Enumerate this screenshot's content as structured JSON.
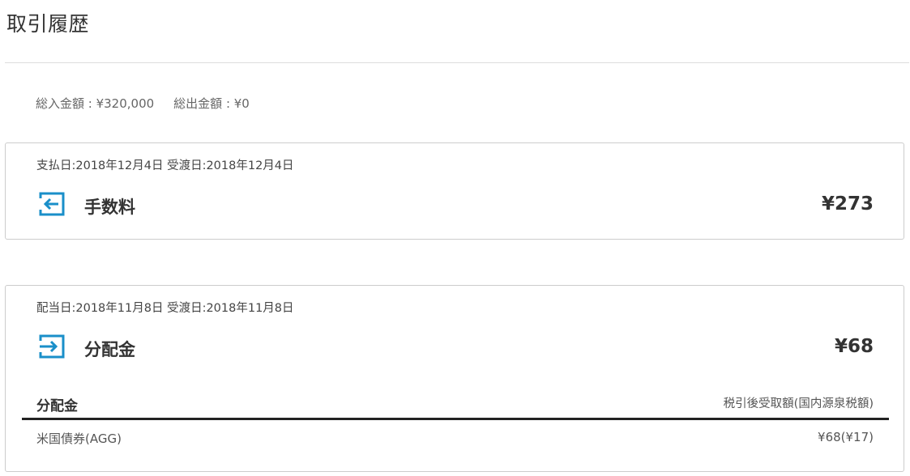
{
  "page": {
    "title": "取引履歴"
  },
  "summary": {
    "total_in": "総入金額 : ¥320,000",
    "total_out": "総出金額 : ¥0"
  },
  "colors": {
    "icon_blue": "#1a8fc9",
    "border": "#cccccc",
    "text": "#333333"
  },
  "transactions": [
    {
      "dates": "支払日:2018年12月4日 受渡日:2018年12月4日",
      "icon": "exit-arrow-left-icon",
      "title": "手数料",
      "amount": "¥273"
    },
    {
      "dates": "配当日:2018年11月8日 受渡日:2018年11月8日",
      "icon": "enter-arrow-right-icon",
      "title": "分配金",
      "amount": "¥68",
      "detail": {
        "header_label": "分配金",
        "header_right": "税引後受取額(国内源泉税額)",
        "rows": [
          {
            "name": "米国債券(AGG)",
            "value": "¥68(¥17)"
          }
        ]
      }
    }
  ]
}
